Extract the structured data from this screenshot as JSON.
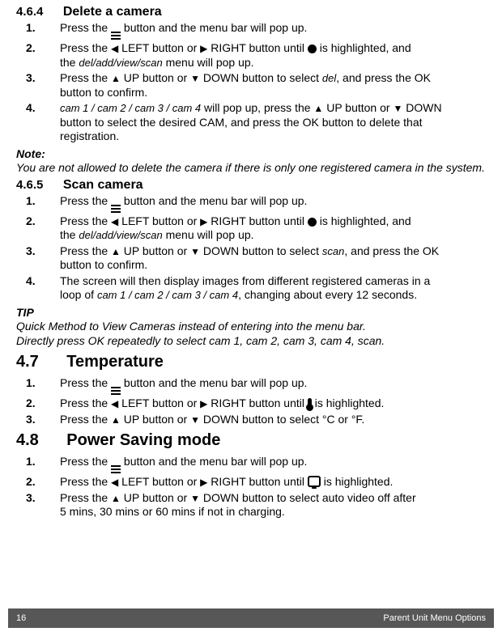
{
  "s464": {
    "number": "4.6.4",
    "title": "Delete a camera",
    "steps": [
      {
        "num": "1.",
        "line1_a": "Press the ",
        "line1_b": " button and the menu bar will pop up."
      },
      {
        "num": "2.",
        "line1_a": "Press the ",
        "left": " LEFT button or ",
        "right": " RIGHT button until ",
        "after_icon": " is highlighted, and",
        "line2_a": "the ",
        "menu": "del/add/view/scan",
        "line2_b": " menu will pop up."
      },
      {
        "num": "3.",
        "line1_a": "Press the ",
        "up": " UP button or ",
        "down": " DOWN button to select ",
        "menu": "del",
        "line1_b": ", and press the OK",
        "line2": "button to confirm."
      },
      {
        "num": "4.",
        "cams": "cam 1 / cam 2 / cam 3 / cam 4",
        "line1_a": " will pop up, press the ",
        "up2": " UP button or ",
        "down2": " DOWN",
        "line2": "button to select the desired CAM, and press the OK button to delete that",
        "line3": "registration."
      }
    ]
  },
  "note1": {
    "title": "Note:",
    "body": "You are not allowed to delete the camera if there is only one registered camera in the system."
  },
  "s465": {
    "number": "4.6.5",
    "title": "Scan camera",
    "steps": [
      {
        "num": "1.",
        "line1_a": "Press the ",
        "line1_b": " button and the menu bar will pop up."
      },
      {
        "num": "2.",
        "line1_a": "Press the ",
        "left": " LEFT button or ",
        "right": " RIGHT button until ",
        "after_icon": " is highlighted, and",
        "line2_a": "the ",
        "menu": "del/add/view/scan",
        "line2_b": " menu will pop up."
      },
      {
        "num": "3.",
        "line1_a": "Press the ",
        "up": " UP button or ",
        "down": " DOWN button to select ",
        "menu": "scan",
        "line1_b": ", and press the OK",
        "line2": "button to confirm."
      },
      {
        "num": "4.",
        "line1": "The screen will then display images from different registered cameras in a",
        "line2_a": "loop of ",
        "cams": "cam 1 / cam 2 / cam 3 / cam 4",
        "line2_b": ", changing about every 12 seconds."
      }
    ]
  },
  "tip": {
    "title": "TIP",
    "body1": "Quick Method to View Cameras instead of entering into the menu bar.",
    "body2_a": "Directly press OK repeatedly to select ",
    "body2_cams": "cam 1, cam 2, cam 3, cam 4, scan.",
    "body2_b": ""
  },
  "s47": {
    "number": "4.7",
    "title": "Temperature",
    "steps": [
      {
        "num": "1.",
        "line1_a": "Press the ",
        "line1_b": " button and the menu bar will pop up."
      },
      {
        "num": "2.",
        "line1_a": "Press the ",
        "left": " LEFT button or ",
        "right": " RIGHT button until ",
        "after_icon": " is highlighted."
      },
      {
        "num": "3.",
        "line1_a": "Press the ",
        "up": " UP button or ",
        "down": " DOWN button to select °C or °F."
      }
    ]
  },
  "s48": {
    "number": "4.8",
    "title": "Power Saving mode",
    "steps": [
      {
        "num": "1.",
        "line1_a": "Press the ",
        "line1_b": " button and the menu bar will pop up."
      },
      {
        "num": "2.",
        "line1_a": "Press the ",
        "left": " LEFT button or ",
        "right": " RIGHT button until ",
        "after_icon": " is highlighted."
      },
      {
        "num": "3.",
        "line1_a": "Press the ",
        "up": " UP button or ",
        "down": " DOWN button to select auto video off after",
        "line2": "5 mins, 30 mins or 60 mins if not in charging."
      }
    ]
  },
  "footer": {
    "page": "16",
    "label": "Parent Unit Menu Options"
  }
}
